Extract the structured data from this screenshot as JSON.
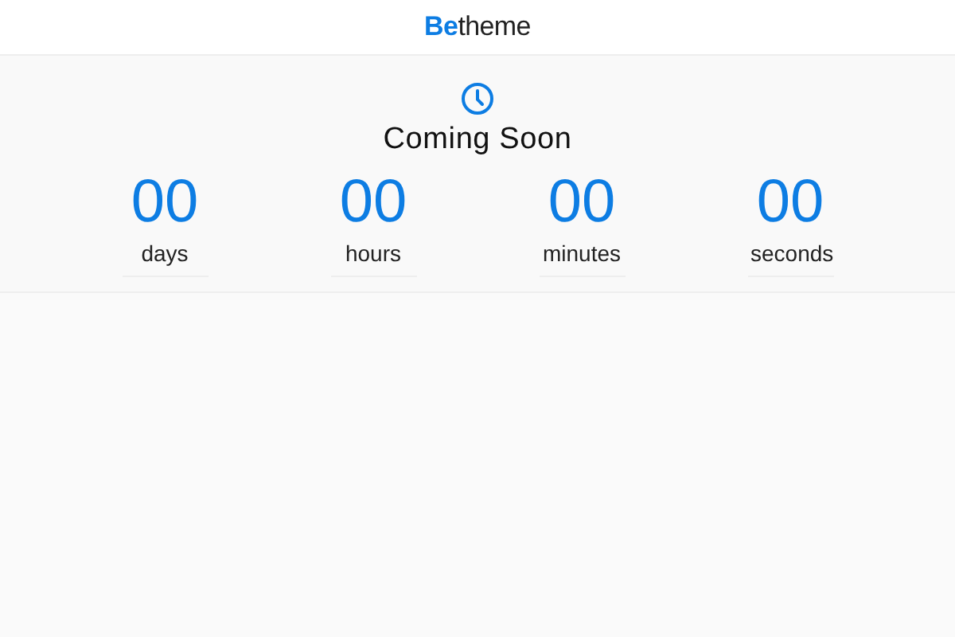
{
  "header": {
    "logo": "**Be**theme"
  },
  "hero": {
    "title": "Coming Soon"
  },
  "countdown": [
    {
      "value": "00",
      "unit": "days"
    },
    {
      "value": "00",
      "unit": "hours"
    },
    {
      "value": "00",
      "unit": "minutes"
    },
    {
      "value": "00",
      "unit": "seconds"
    }
  ]
}
